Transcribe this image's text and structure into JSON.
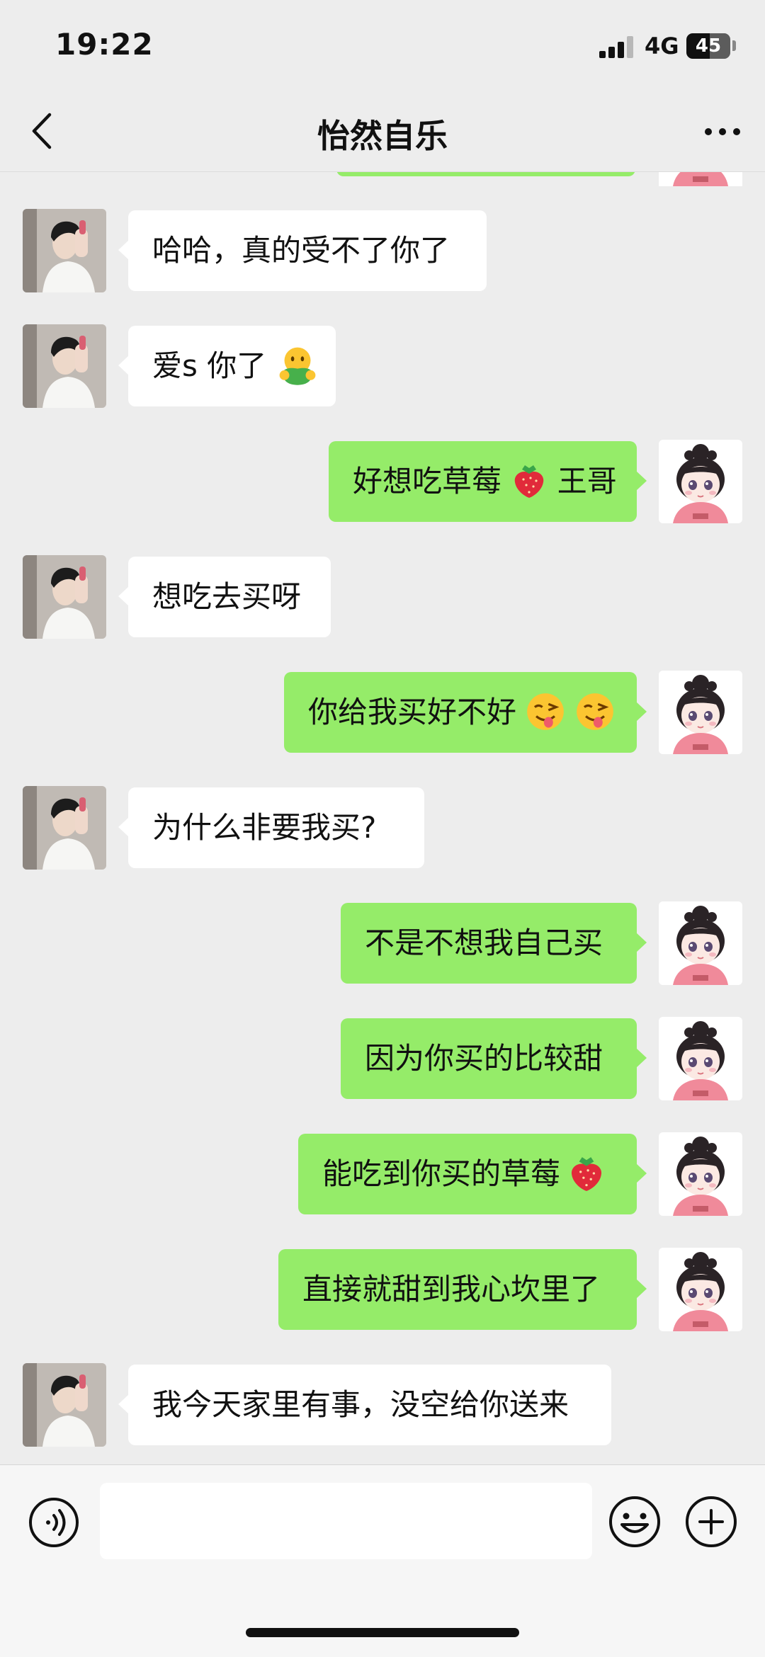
{
  "status_bar": {
    "time": "19:22",
    "network": "4G",
    "battery": "45"
  },
  "header": {
    "title": "怡然自乐"
  },
  "messages": [
    {
      "side": "left",
      "text": "哈哈，真的受不了你了"
    },
    {
      "side": "left",
      "text": "爱s 你了"
    },
    {
      "side": "right",
      "text_before": "好想吃草莓",
      "text_after": "王哥"
    },
    {
      "side": "left",
      "text": "想吃去买呀"
    },
    {
      "side": "right",
      "text": "你给我买好不好"
    },
    {
      "side": "left",
      "text": "为什么非要我买?"
    },
    {
      "side": "right",
      "text": "不是不想我自己买"
    },
    {
      "side": "right",
      "text": "因为你买的比较甜"
    },
    {
      "side": "right",
      "text": "能吃到你买的草莓"
    },
    {
      "side": "right",
      "text": "直接就甜到我心坎里了"
    },
    {
      "side": "left",
      "text": "我今天家里有事，没空给你送来"
    }
  ],
  "icons": {
    "back": "chevron-left-icon",
    "more": "more-dots-icon",
    "voice": "voice-icon",
    "emoji": "emoji-icon",
    "plus": "plus-icon",
    "strawberry": "strawberry-emoji-icon",
    "wink": "winking-tongue-emoji-icon",
    "hug": "hug-emoji-icon"
  },
  "colors": {
    "background": "#ededed",
    "sent_bubble": "#95ec69",
    "received_bubble": "#ffffff"
  }
}
